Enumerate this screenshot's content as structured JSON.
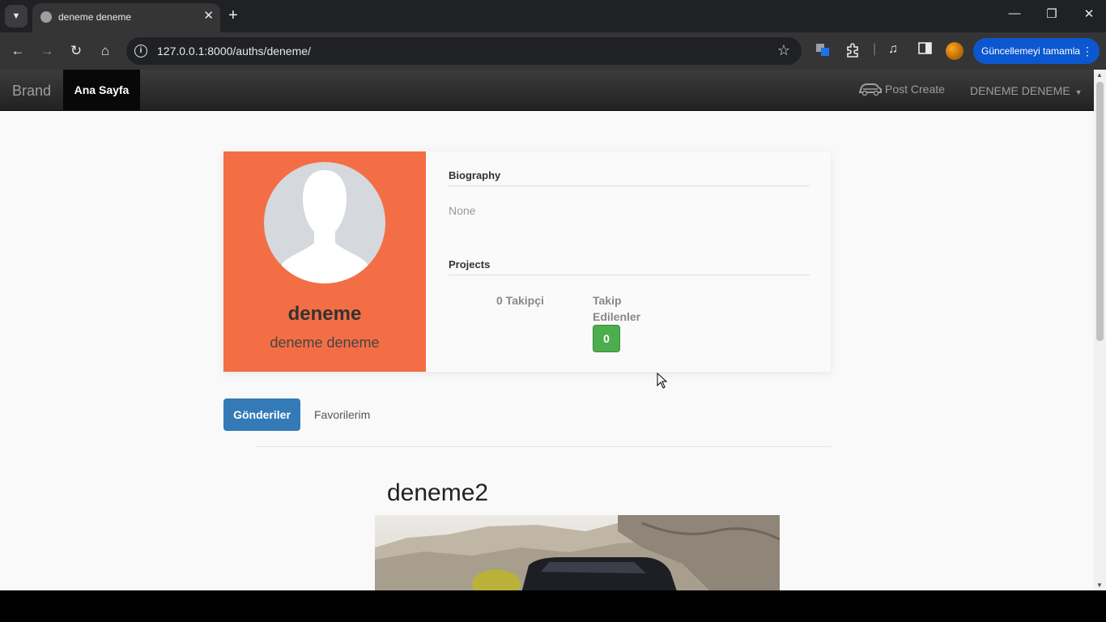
{
  "browser": {
    "tab_title": "deneme deneme",
    "url": "127.0.0.1:8000/auths/deneme/",
    "update_button": "Güncellemeyi tamamla"
  },
  "navbar": {
    "brand": "Brand",
    "active_item": "Ana Sayfa",
    "post_create": "Post Create",
    "user_menu": "DENEME DENEME"
  },
  "profile": {
    "username": "deneme",
    "full_name": "deneme deneme",
    "biography_title": "Biography",
    "biography_text": "None",
    "projects_title": "Projects",
    "followers": "0 Takipçi",
    "following_label_line1": "Takip",
    "following_label_line2": "Edilenler",
    "following_count": "0"
  },
  "tabs": {
    "posts": "Gönderiler",
    "favorites": "Favorilerim"
  },
  "post": {
    "title": "deneme2"
  },
  "colors": {
    "card_accent": "#f46e45",
    "primary": "#337ab7",
    "success": "#4cae4c"
  }
}
